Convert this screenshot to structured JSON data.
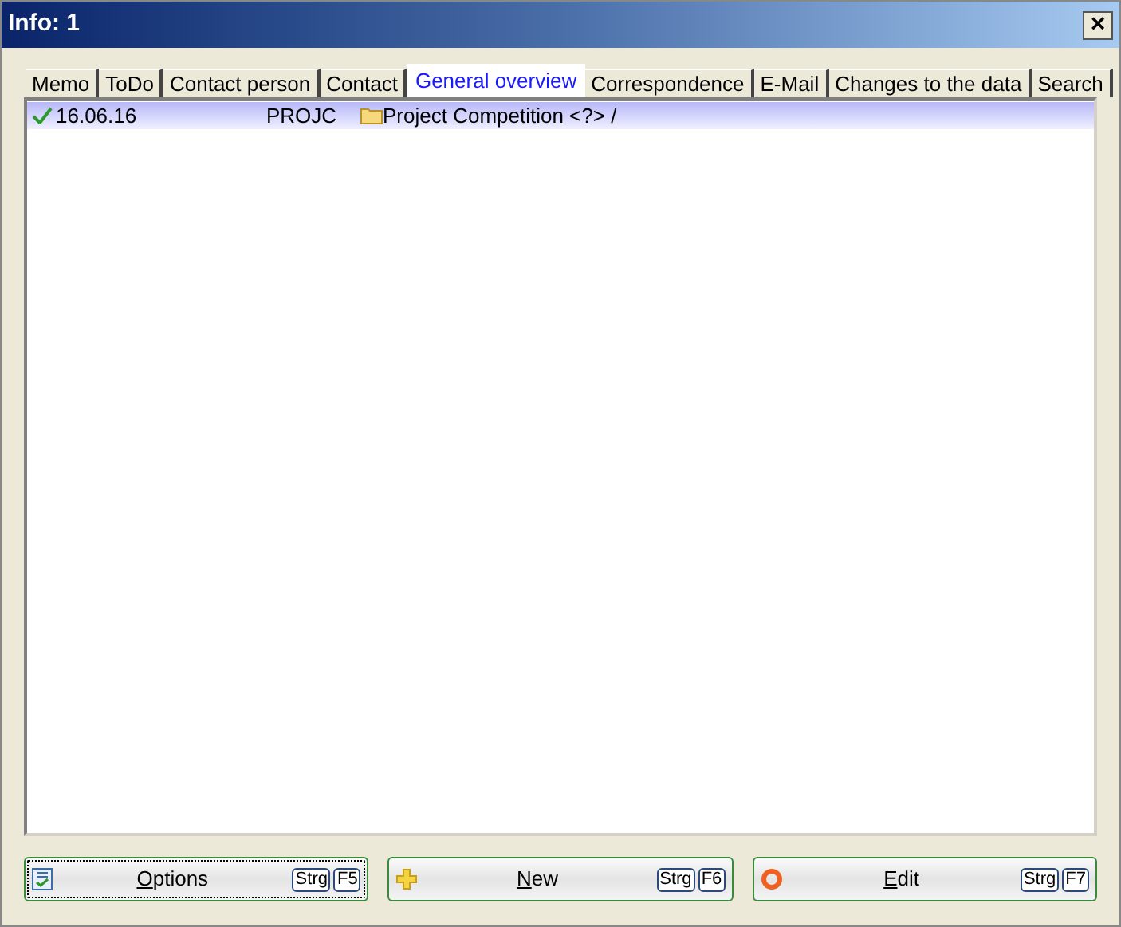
{
  "window": {
    "title": "Info: 1",
    "close": "×"
  },
  "tabs": [
    {
      "label": "Memo",
      "selected": false
    },
    {
      "label": "ToDo",
      "selected": false
    },
    {
      "label": "Contact person",
      "selected": false
    },
    {
      "label": "Contact",
      "selected": false
    },
    {
      "label": "General overview",
      "selected": true
    },
    {
      "label": "Correspondence",
      "selected": false
    },
    {
      "label": "E-Mail",
      "selected": false
    },
    {
      "label": "Changes to the data",
      "selected": false
    },
    {
      "label": "Search",
      "selected": false
    }
  ],
  "rows": [
    {
      "date": "16.06.16",
      "code": "PROJC",
      "title": "Project Competition <?> /",
      "done": true,
      "selected": true
    }
  ],
  "buttons": [
    {
      "kind": "options",
      "label": "Options",
      "keys": [
        "Strg",
        "F5"
      ],
      "focused": true
    },
    {
      "kind": "new",
      "label": "New",
      "keys": [
        "Strg",
        "F6"
      ],
      "focused": false
    },
    {
      "kind": "edit",
      "label": "Edit",
      "keys": [
        "Strg",
        "F7"
      ],
      "focused": false
    }
  ]
}
